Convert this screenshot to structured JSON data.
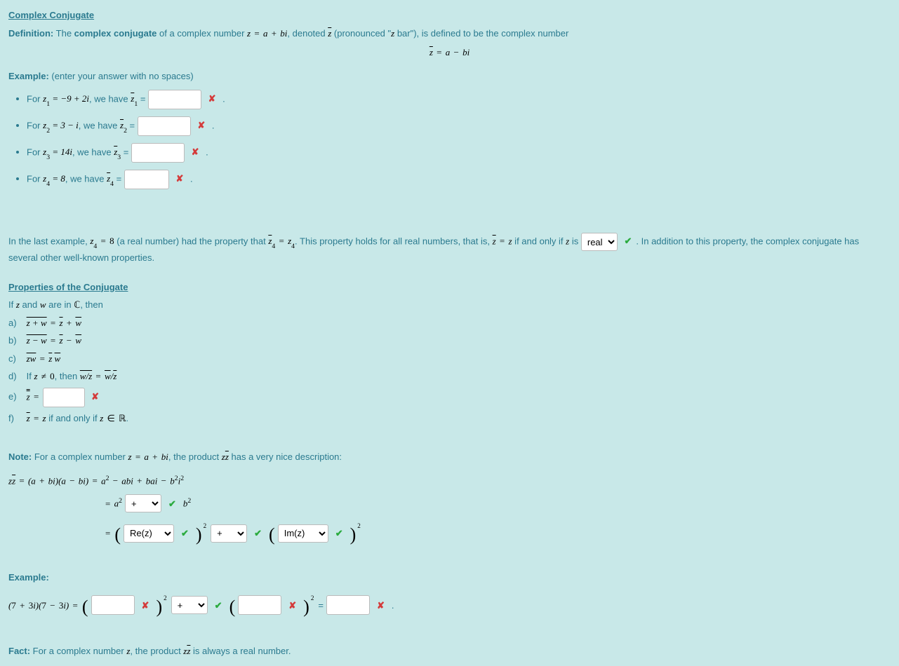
{
  "title_conjugate": "Complex Conjugate",
  "def_prefix": "Definition:",
  "def_text1": " The ",
  "def_bold": "complex conjugate",
  "def_text2": " of a complex number ",
  "def_text3": ", denoted ",
  "def_text4": " (pronounced \"",
  "def_text5": " bar\"),  is defined to be the complex number",
  "example_prefix": "Example:",
  "example_hint": " (enter your answer with no spaces)",
  "items": [
    {
      "pre": "For ",
      "lhs1": "z",
      "sub": "1",
      "eq": " = −9 + 2i",
      "mid": ", we have ",
      "bar": "z",
      "barsub": "1",
      "tail": " = "
    },
    {
      "pre": "For ",
      "lhs1": "z",
      "sub": "2",
      "eq": " = 3 − i",
      "mid": ", we have ",
      "bar": "z",
      "barsub": "2",
      "tail": " = "
    },
    {
      "pre": "For ",
      "lhs1": "z",
      "sub": "3",
      "eq": " = 14i",
      "mid": ", we have ",
      "bar": "z",
      "barsub": "3",
      "tail": " = "
    },
    {
      "pre": "For ",
      "lhs1": "z",
      "sub": "4",
      "eq": " = 8",
      "mid": ", we have ",
      "bar": "z",
      "barsub": "4",
      "tail": " = "
    }
  ],
  "para_last_1": "In the last example, ",
  "para_last_2": " (a real number) had the property that ",
  "para_last_3": ". This property holds for all real numbers, that is,  ",
  "para_last_4": " if and only if ",
  "para_last_5": " is",
  "para_last_6": ".  In addition to this property, the complex conjugate has several other well-known properties.",
  "select_options": [
    "real"
  ],
  "title_props": "Properties of the Conjugate",
  "props_intro_1": "If ",
  "props_intro_2": " and ",
  "props_intro_3": " are in ",
  "props_intro_4": ", then",
  "prop_labels": [
    "a)",
    "b)",
    "c)",
    "d)",
    "e)",
    "f)"
  ],
  "prop_d_pre": "  If ",
  "prop_d_mid": ",  then  ",
  "prop_f_text": "  if and only if  ",
  "note_prefix": "Note:",
  "note_text1": " For a complex number ",
  "note_text2": ", the product ",
  "note_text3": " has a very nice description:",
  "der_sel1_options": [
    "+"
  ],
  "der_sel2_options": [
    "Re(z)"
  ],
  "der_sel3_options": [
    "+"
  ],
  "der_sel4_options": [
    "Im(z)"
  ],
  "ex2_prefix": "Example:",
  "ex2_sel_options": [
    "+"
  ],
  "ex2_equals": " = ",
  "fact_prefix": "Fact:",
  "fact_text1": " For a complex number ",
  "fact_text2": ", the product ",
  "fact_text3": " is always a real number.",
  "period": " .",
  "dot": "."
}
